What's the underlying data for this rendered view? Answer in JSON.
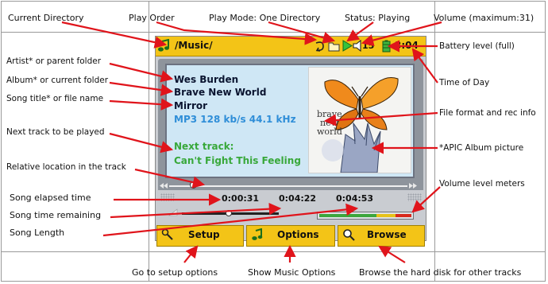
{
  "device": {
    "path": "/Music/",
    "volume": "15",
    "clock": "3:04",
    "artist": "Wes Burden",
    "album": "Brave New World",
    "song": "Mirror",
    "format": "MP3 128 kb/s 44.1 kHz",
    "next_label": "Next track:",
    "next_title": "Can't Fight This Feeling",
    "elapsed": "0:00:31",
    "remaining": "0:04:22",
    "length": "0:04:53",
    "buttons": [
      "Setup",
      "Options",
      "Browse"
    ],
    "track_progress": 0.1,
    "volume_level": 0.48,
    "colors": {
      "accent": "#f3c417",
      "screen": "#cfe7f5",
      "callout": "#e0141b",
      "format_text": "#2f8ed8",
      "next_text": "#38a83a"
    }
  },
  "callouts": {
    "current_directory": "Current Directory",
    "play_order": "Play Order",
    "play_mode": "Play Mode: One Directory",
    "status": "Status: Playing",
    "volume_max": "Volume (maximum:31)",
    "battery": "Battery level (full)",
    "artist": "Artist* or parent folder",
    "album": "Album* or current folder",
    "song_title": "Song title* or file name",
    "time_of_day": "Time of Day",
    "file_format": "File format and rec info",
    "next_track": "Next track to be played",
    "album_picture": "*APIC Album picture",
    "relative_location": "Relative location in the track",
    "volume_meters": "Volume level meters",
    "elapsed": "Song elapsed time",
    "remaining": "Song time remaining",
    "length": "Song Length",
    "setup": "Go to setup options",
    "music_options": "Show Music Options",
    "browse": "Browse the hard disk for other tracks"
  },
  "art": {
    "line1": "brave",
    "line2": "new",
    "line3": "world"
  }
}
